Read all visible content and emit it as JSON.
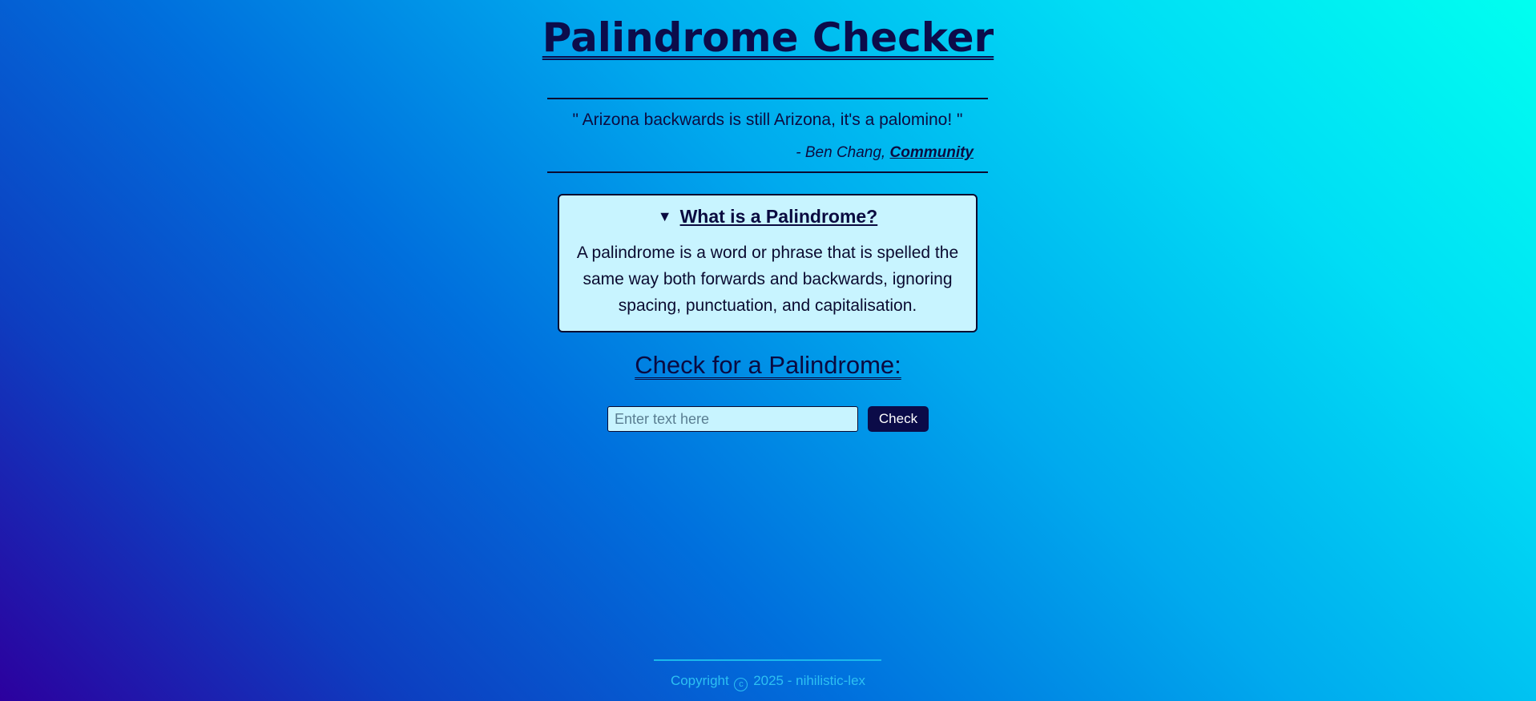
{
  "header": {
    "title": "Palindrome Checker"
  },
  "quote": {
    "text": "\" Arizona backwards is still Arizona, it's a palomino! \"",
    "attribution_prefix": "- Ben Chang, ",
    "source": "Community"
  },
  "info": {
    "summary_icon": "triangle-down-icon",
    "summary": "What is a Palindrome?",
    "body": "A palindrome is a word or phrase that is spelled the same way both forwards and backwards, ignoring spacing, punctuation, and capitalisation."
  },
  "checker": {
    "heading": "Check for a Palindrome:",
    "input_value": "",
    "input_placeholder": "Enter text here",
    "button_label": "Check"
  },
  "footer": {
    "copyright_label": "Copyright",
    "copyright_icon": "copyright-icon",
    "year_author": "2025 - nihilistic-lex"
  },
  "colors": {
    "accent_dark": "#0b0b48",
    "box_background": "#c8f4ff",
    "footer_text": "#2dc0f2"
  }
}
